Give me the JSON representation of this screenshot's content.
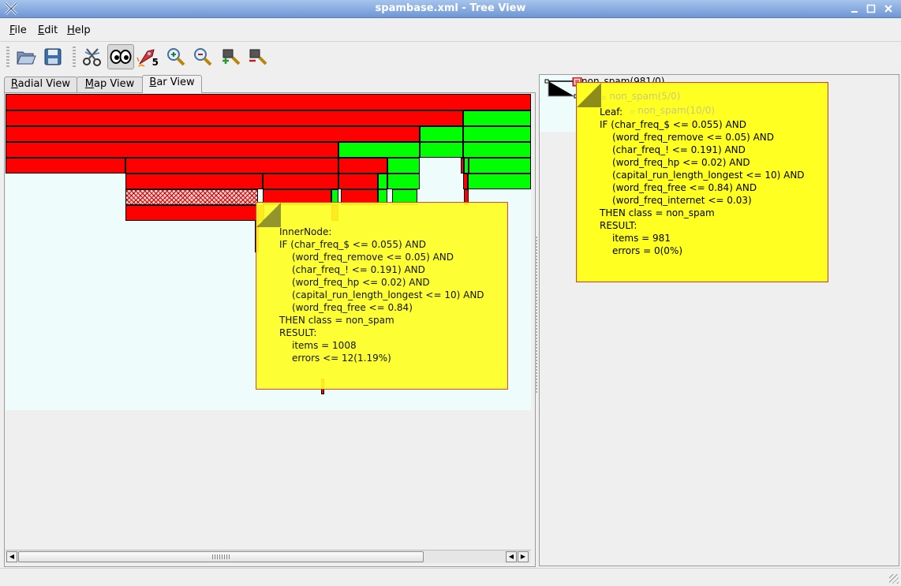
{
  "window": {
    "title": "spambase.xml - Tree View",
    "controls": [
      "minimize",
      "maximize",
      "close"
    ]
  },
  "menubar": {
    "items": [
      {
        "label_first": "F",
        "label_rest": "ile"
      },
      {
        "label_first": "E",
        "label_rest": "dit"
      },
      {
        "label_first": "H",
        "label_rest": "elp"
      }
    ]
  },
  "toolbar": {
    "buttons": [
      "open-folder-icon",
      "save-icon",
      "cut-tree-icon",
      "view-eyes-icon",
      "rocket-icon",
      "zoom-in-icon",
      "zoom-out-icon",
      "zoom-in-node-icon",
      "zoom-out-node-icon"
    ],
    "rocket_badge": "5"
  },
  "tabs": [
    {
      "label_first": "R",
      "label_rest": "adial View"
    },
    {
      "label_first": "M",
      "label_rest": "ap View"
    },
    {
      "label_first": "B",
      "label_rest": "ar View",
      "active": true
    }
  ],
  "colors": {
    "spam": "#ff0000",
    "non_spam": "#00ff00",
    "tooltip_bg": "#ffff22",
    "tooltip_border": "#d93a3a",
    "canvas_bg": "#eefcfc"
  },
  "inner_tooltip": {
    "lines": [
      "InnerNode:",
      "IF (char_freq_$ <= 0.055) AND",
      "(word_freq_remove <= 0.05) AND",
      "(char_freq_! <= 0.191) AND",
      "(word_freq_hp <= 0.02) AND",
      "(capital_run_length_longest <= 10) AND",
      "(word_freq_free <= 0.84)",
      "THEN class = non_spam",
      "RESULT:",
      "items = 1008",
      "errors <= 12(1.19%)"
    ]
  },
  "tree": {
    "root_label": "non_spam(981/0)",
    "child_labels": [
      "non_spam(5/0)",
      "non_spam(10/0)"
    ]
  },
  "leaf_tooltip": {
    "lines": [
      "Leaf:",
      "IF (char_freq_$ <= 0.055) AND",
      "(word_freq_remove <= 0.05) AND",
      "(char_freq_! <= 0.191) AND",
      "(word_freq_hp <= 0.02) AND",
      "(capital_run_length_longest <= 10) AND",
      "(word_freq_free <= 0.84) AND",
      "(word_freq_internet <= 0.03)",
      "THEN class = non_spam",
      "RESULT:",
      "items = 981",
      "errors = 0(0%)"
    ]
  }
}
